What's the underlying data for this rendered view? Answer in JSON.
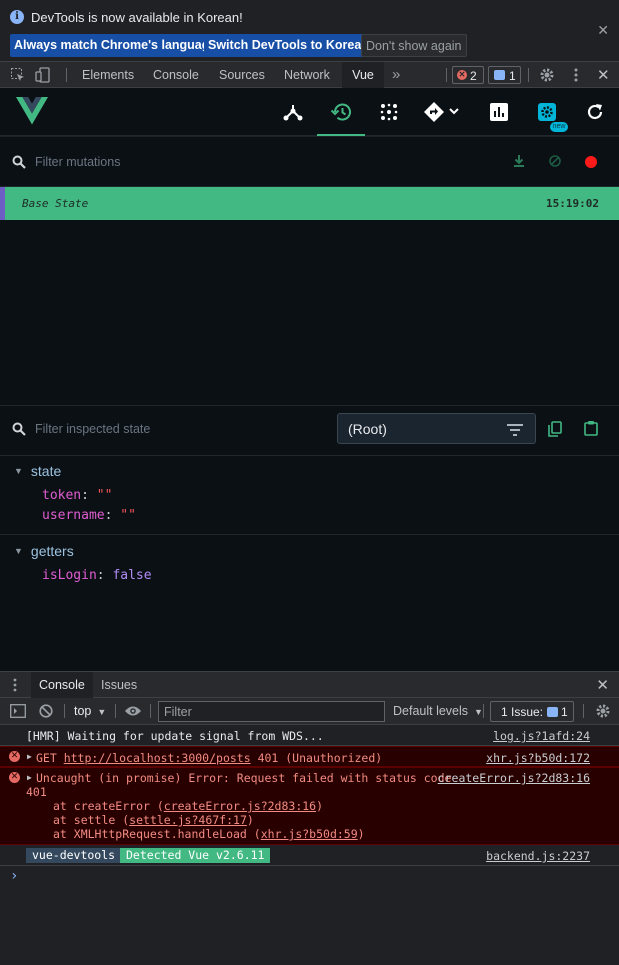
{
  "infobar": {
    "message": "DevTools is now available in Korean!",
    "btn_match": "Always match Chrome's language",
    "btn_switch": "Switch DevTools to Korean",
    "btn_dismiss": "Don't show again"
  },
  "tabs": {
    "elements": "Elements",
    "console": "Console",
    "sources": "Sources",
    "network": "Network",
    "vue": "Vue",
    "more": "»",
    "error_count": "2",
    "issue_count": "1"
  },
  "vue_toolbar": {
    "new_badge": "new"
  },
  "mutations": {
    "filter_placeholder": "Filter mutations",
    "base_state_label": "Base State",
    "base_state_time": "15:19:02"
  },
  "inspector": {
    "filter_placeholder": "Filter inspected state",
    "root_select": "(Root)",
    "state_title": "state",
    "state_items": [
      {
        "key": "token",
        "value": "\"\""
      },
      {
        "key": "username",
        "value": "\"\""
      }
    ],
    "getters_title": "getters",
    "getter_items": [
      {
        "key": "isLogin",
        "value": "false"
      }
    ]
  },
  "drawer": {
    "tab_console": "Console",
    "tab_issues": "Issues",
    "context": "top",
    "filter_placeholder": "Filter",
    "levels": "Default levels",
    "issues_label": "1 Issue:",
    "issues_count": "1"
  },
  "console": {
    "hmr": "[HMR] Waiting for update signal from WDS...",
    "hmr_src": "log.js?1afd:24",
    "get_prefix": "GET ",
    "get_url": "http://localhost:3000/posts",
    "get_suffix": " 401 (Unauthorized)",
    "get_src": "xhr.js?b50d:172",
    "uncaught": "Uncaught (in promise) Error: Request failed with status code",
    "uncaught_code": "401",
    "uncaught_src": "createError.js?2d83:16",
    "stack": [
      {
        "prefix": "at createError (",
        "link": "createError.js?2d83:16",
        "suffix": ")"
      },
      {
        "prefix": "at settle (",
        "link": "settle.js?467f:17",
        "suffix": ")"
      },
      {
        "prefix": "at XMLHttpRequest.handleLoad (",
        "link": "xhr.js?b50d:59",
        "suffix": ")"
      }
    ],
    "devtools_badge": "vue-devtools",
    "detected": "Detected Vue v2.6.11",
    "devtools_src": "backend.js:2237",
    "prompt": "›"
  }
}
